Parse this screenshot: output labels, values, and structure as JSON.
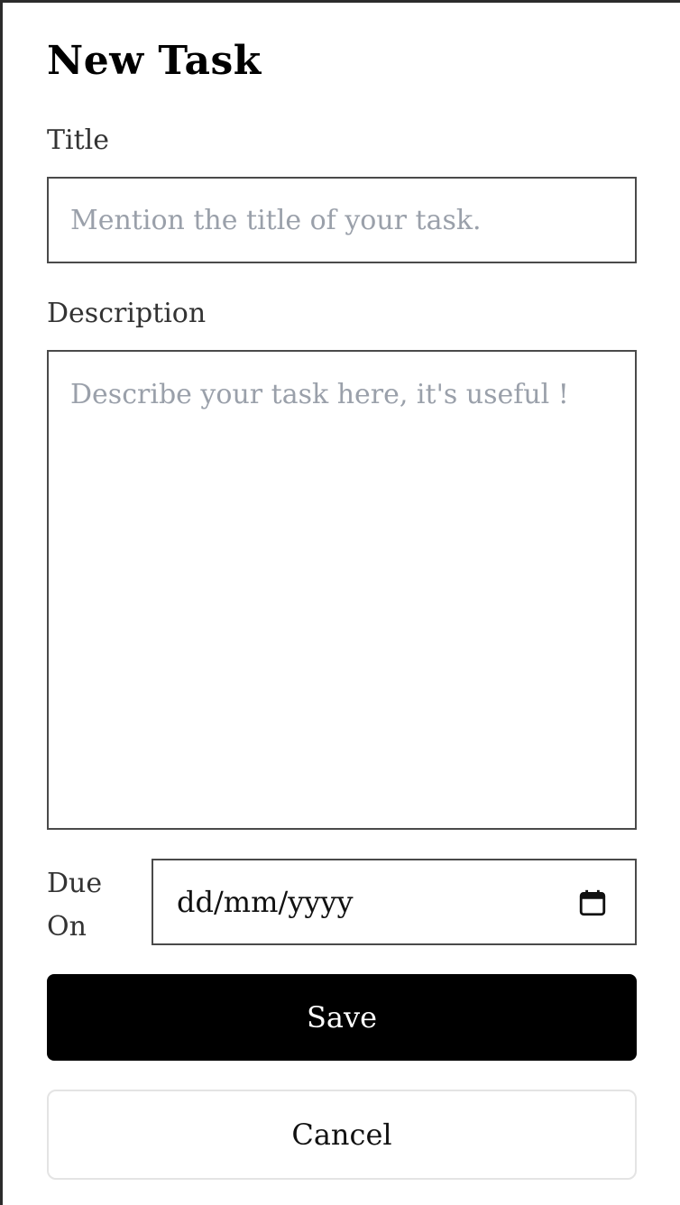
{
  "form": {
    "heading": "New Task",
    "title_label": "Title",
    "title_placeholder": "Mention the title of your task.",
    "title_value": "",
    "description_label": "Description",
    "description_placeholder": "Describe your task here, it's useful !",
    "description_value": "",
    "due_label": "Due On",
    "due_value": "dd/mm/yyyy",
    "save_label": "Save",
    "cancel_label": "Cancel"
  },
  "icons": {
    "calendar": "calendar-icon"
  },
  "colors": {
    "primary_button": "#000000",
    "placeholder": "#9aa0aa",
    "border": "#4a4a4a"
  }
}
